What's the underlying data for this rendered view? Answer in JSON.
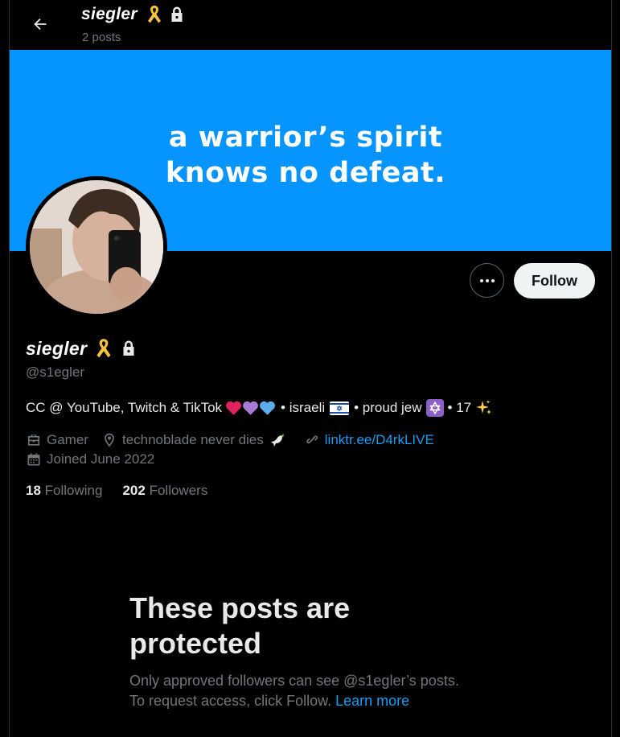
{
  "header": {
    "display_name": "siegler",
    "post_count": "2 posts"
  },
  "banner": {
    "line1": "a warrior’s spirit",
    "line2": "knows no defeat."
  },
  "actions": {
    "follow_label": "Follow"
  },
  "profile": {
    "display_name": "siegler",
    "handle": "@s1egler",
    "bio_part1": "CC @ YouTube, Twitch & TikTok",
    "bio_part2": "• israeli",
    "bio_part3": "• proud jew",
    "bio_part4": "• 17",
    "category": "Gamer",
    "location": "technoblade never dies",
    "website": "linktr.ee/D4rkLIVE",
    "joined": "Joined June 2022",
    "following_count": "18",
    "following_label": "Following",
    "followers_count": "202",
    "followers_label": "Followers"
  },
  "protected": {
    "title_line1": "These posts are",
    "title_line2": "protected",
    "desc_line1": "Only approved followers can see @s1egler’s posts.",
    "desc_line2": "To request access, click Follow.",
    "learn_more": "Learn more"
  },
  "colors": {
    "banner": "#0695ff",
    "accent_link": "#1d9bf0",
    "ribbon": "#f7c23c"
  }
}
